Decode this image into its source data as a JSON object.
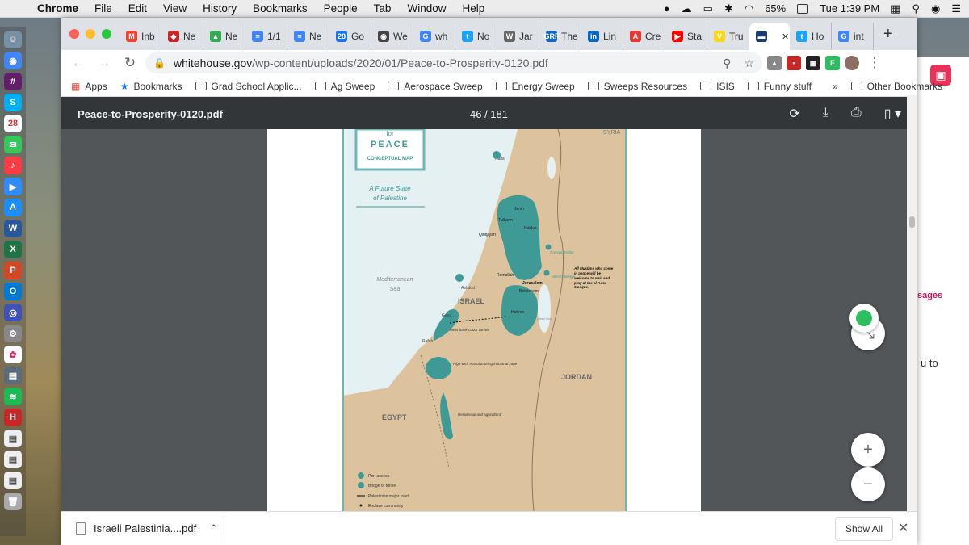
{
  "menubar": {
    "app_name": "Chrome",
    "menus": [
      "File",
      "Edit",
      "View",
      "History",
      "Bookmarks",
      "People",
      "Tab",
      "Window",
      "Help"
    ],
    "battery": "65%",
    "clock": "Tue 1:39 PM"
  },
  "tabs": [
    {
      "label": "Inb",
      "fav": "M",
      "color": "#ea4335"
    },
    {
      "label": "Ne",
      "fav": "◆",
      "color": "#c62828"
    },
    {
      "label": "Ne",
      "fav": "▲",
      "color": "#34a853"
    },
    {
      "label": "1/1",
      "fav": "≡",
      "color": "#4285f4"
    },
    {
      "label": "Ne",
      "fav": "≡",
      "color": "#4285f4"
    },
    {
      "label": "Go",
      "fav": "28",
      "color": "#1a73e8"
    },
    {
      "label": "We",
      "fav": "◉",
      "color": "#444"
    },
    {
      "label": "wh",
      "fav": "G",
      "color": "#4285f4"
    },
    {
      "label": "No",
      "fav": "t",
      "color": "#1da1f2"
    },
    {
      "label": "Jar",
      "fav": "W",
      "color": "#666"
    },
    {
      "label": "The",
      "fav": "GRF",
      "color": "#1565c0"
    },
    {
      "label": "Lin",
      "fav": "in",
      "color": "#0a66c2"
    },
    {
      "label": "Cre",
      "fav": "A",
      "color": "#e53935"
    },
    {
      "label": "Sta",
      "fav": "▶",
      "color": "#ff0000"
    },
    {
      "label": "Tru",
      "fav": "V",
      "color": "#f9d71c"
    },
    {
      "label": "",
      "fav": "▬",
      "color": "#1c3b6b",
      "active": true
    },
    {
      "label": "Ho",
      "fav": "t",
      "color": "#1da1f2"
    },
    {
      "label": "int",
      "fav": "G",
      "color": "#4285f4"
    }
  ],
  "toolbar": {
    "url_host": "whitehouse.gov",
    "url_path": "/wp-content/uploads/2020/01/Peace-to-Prosperity-0120.pdf"
  },
  "bookmarks": {
    "apps": "Apps",
    "items": [
      "Bookmarks",
      "Grad School Applic...",
      "Ag Sweep",
      "Aerospace Sweep",
      "Energy Sweep",
      "Sweeps Resources",
      "ISIS",
      "Funny stuff"
    ],
    "more": "»",
    "other": "Other Bookmarks"
  },
  "pdf": {
    "filename": "Peace-to-Prosperity-0120.pdf",
    "page_indicator": "46 / 181"
  },
  "map": {
    "title_top": "for",
    "title_main": "PEACE",
    "title_sub": "CONCEPTUAL MAP",
    "subtitle_line1": "A Future State",
    "subtitle_line2": "of Palestine",
    "labels": {
      "syria": "SYRIA",
      "haifa": "Haifa",
      "med_sea_1": "Mediterranean",
      "med_sea_2": "Sea",
      "israel": "ISRAEL",
      "jordan": "JORDAN",
      "egypt": "EGYPT",
      "ashdod": "Ashdod",
      "gaza": "Gaza",
      "rafah": "Rafah",
      "jenin": "Jenin",
      "tulkarm": "Tulkarm",
      "nablus": "Nablus",
      "qalqilyah": "Qalqilyah",
      "ramallah": "Ramallah",
      "jerusalem": "Jerusalem",
      "bethlehem": "Bethlehem",
      "hebron": "Hebron",
      "dead_sea": "Dead Sea",
      "damiya_bridge": "Damiya Bridge",
      "allenby_bridge": "Allenby Bridge",
      "tunnel": "West Bank-Gaza Tunnel",
      "hightech": "High-tech manufacturing industrial zone",
      "residential": "Residential and agricultural",
      "note": "All Muslims who come in peace will be welcome to visit and pray at the al-Aqsa Mosque."
    },
    "legend": [
      "Port access",
      "Bridge or tunnel",
      "Palestinian major road",
      "Enclave community"
    ]
  },
  "download": {
    "file": "Israeli Palestinia....pdf",
    "show_all": "Show All"
  },
  "background_window": {
    "messages": "sages",
    "to": "u to"
  },
  "colors": {
    "land": "#dcc39d",
    "sea": "#e4f0f2",
    "palestine": "#3f9a96",
    "border_teal": "#6fb5b4"
  }
}
